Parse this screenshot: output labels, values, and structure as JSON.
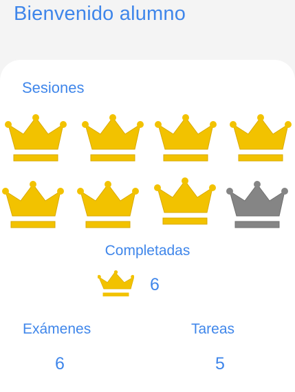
{
  "header": {
    "title": "Bienvenido alumno"
  },
  "sessions": {
    "title": "Sesiones",
    "items": [
      {
        "status": "completed"
      },
      {
        "status": "completed"
      },
      {
        "status": "completed"
      },
      {
        "status": "completed"
      },
      {
        "status": "completed"
      },
      {
        "status": "completed"
      },
      {
        "status": "completed"
      },
      {
        "status": "pending"
      }
    ]
  },
  "completed": {
    "title": "Completadas",
    "count": "6",
    "icon": "crown-icon"
  },
  "stats": {
    "exams_label": "Exámenes",
    "exams_value": "6",
    "tasks_label": "Tareas",
    "tasks_value": "5"
  },
  "colors": {
    "accent": "#3f86ea",
    "crown_completed": "#f2c200",
    "crown_pending": "#858585",
    "background": "#f4f4f4",
    "card": "#ffffff"
  }
}
